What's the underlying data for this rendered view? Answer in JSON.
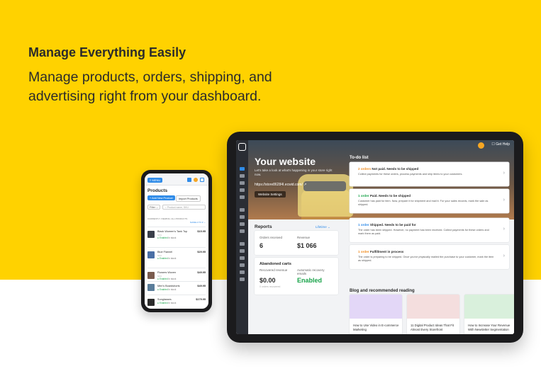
{
  "hero": {
    "title": "Manage Everything Easily",
    "subtitle": "Manage products, orders, shipping, and advertising right from your dashboard."
  },
  "tablet": {
    "get_help": "Get Help",
    "site": {
      "title": "Your website",
      "description": "Let's take a look at what's happening in your store right now.",
      "url": "https://store86284I.ecwid.com/",
      "settings_button": "Website Settings"
    },
    "reports": {
      "heading": "Reports",
      "period": "Lifetime",
      "orders_label": "Orders received",
      "orders_value": "6",
      "revenue_label": "Revenue",
      "revenue_value": "$1 066",
      "abandoned_heading": "Abandoned carts",
      "recovered_label": "Recovered revenue",
      "recovered_value": "$0.00",
      "recovered_sub": "0 orders recovered",
      "auto_label": "Automatic recovery emails",
      "auto_value": "Enabled"
    },
    "todo": {
      "heading": "To-do list",
      "items": [
        {
          "count": "2 orders",
          "title": "Not paid. Needs to be shipped",
          "desc": "Collect payments for these orders, process payments and ship items to your customers."
        },
        {
          "count": "1 order",
          "title": "Paid. Needs to be shipped",
          "desc": "Customer has paid for item. Now, prepare it for shipment and mail it. For your sales records, mark the sale as shipped."
        },
        {
          "count": "1 order",
          "title": "Shipped. Needs to be paid for",
          "desc": "The order has been shipped. However, no payment has been received. Collect payments for these orders and mark them as paid."
        },
        {
          "count": "1 order",
          "title": "Fulfillment in process",
          "desc": "The order is preparing to be shipped. Once you've physically mailed the purchase to your customer, mark the item as shipped."
        }
      ]
    },
    "blog": {
      "heading": "Blog and recommended reading",
      "items": [
        {
          "title": "How to Use Video in E-commerce Marketing",
          "color": "#e3d7f7"
        },
        {
          "title": "11 Digital Product Ideas That Fit Almost Every Storefront",
          "color": "#f4dede"
        },
        {
          "title": "How to Increase Your Revenue With Newsletter Segmentation",
          "color": "#d9f0dc"
        }
      ]
    }
  },
  "phone": {
    "menu": "MENU",
    "title": "Products",
    "add_button": "+ Add New Product",
    "import_button": "Import Products",
    "filter": "Filter",
    "search_placeholder": "Product name, SKU",
    "viewing": "CURRENTLY VIEWING: ALL PRODUCTS",
    "sort": "NAME A TO Z",
    "products": [
      {
        "name": "Black Women's Tank Top",
        "sku": "SKU",
        "status": "Enabled",
        "stock": "In stock",
        "price": "$15.95",
        "color": "#3a3f4a"
      },
      {
        "name": "Blue Flannel",
        "sku": "SKU",
        "status": "Enabled",
        "stock": "In stock",
        "price": "$29.95",
        "color": "#4a6fa5"
      },
      {
        "name": "Flowers Woven",
        "sku": "SKU",
        "status": "Enabled",
        "stock": "In stock",
        "price": "$49.95",
        "color": "#7a5c4e"
      },
      {
        "name": "Men's Boardshorts",
        "sku": "SKU",
        "status": "Enabled",
        "stock": "In stock",
        "price": "$49.95",
        "color": "#5a7d9a"
      },
      {
        "name": "Sunglasses",
        "sku": "SKU",
        "status": "Enabled",
        "stock": "In stock",
        "price": "$179.95",
        "color": "#2b2b2b"
      }
    ]
  }
}
